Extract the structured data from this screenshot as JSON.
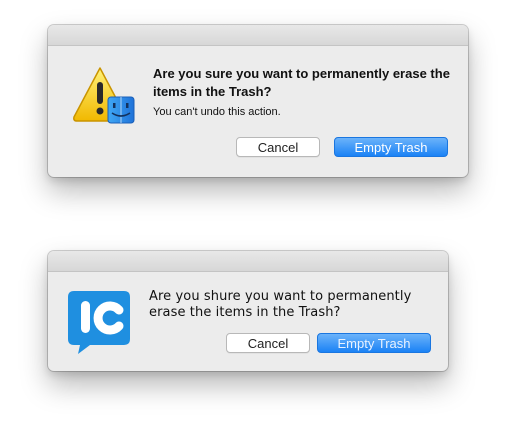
{
  "dialog1": {
    "title": "Are you sure you want to permanently erase the items in the Trash?",
    "info": "You can't undo this action.",
    "cancel_label": "Cancel",
    "confirm_label": "Empty Trash",
    "icon": "caution-finder-icon"
  },
  "dialog2": {
    "message": "Are you shure you want to permanently erase the items in the Trash?",
    "cancel_label": "Cancel",
    "confirm_label": "Empty Trash",
    "icon": "lc-chat-logo-icon"
  },
  "colors": {
    "dialog_bg": "#ececec",
    "accent_blue": "#1b82f5",
    "warning_yellow": "#f5c400",
    "logo_blue": "#1f8fe0"
  }
}
